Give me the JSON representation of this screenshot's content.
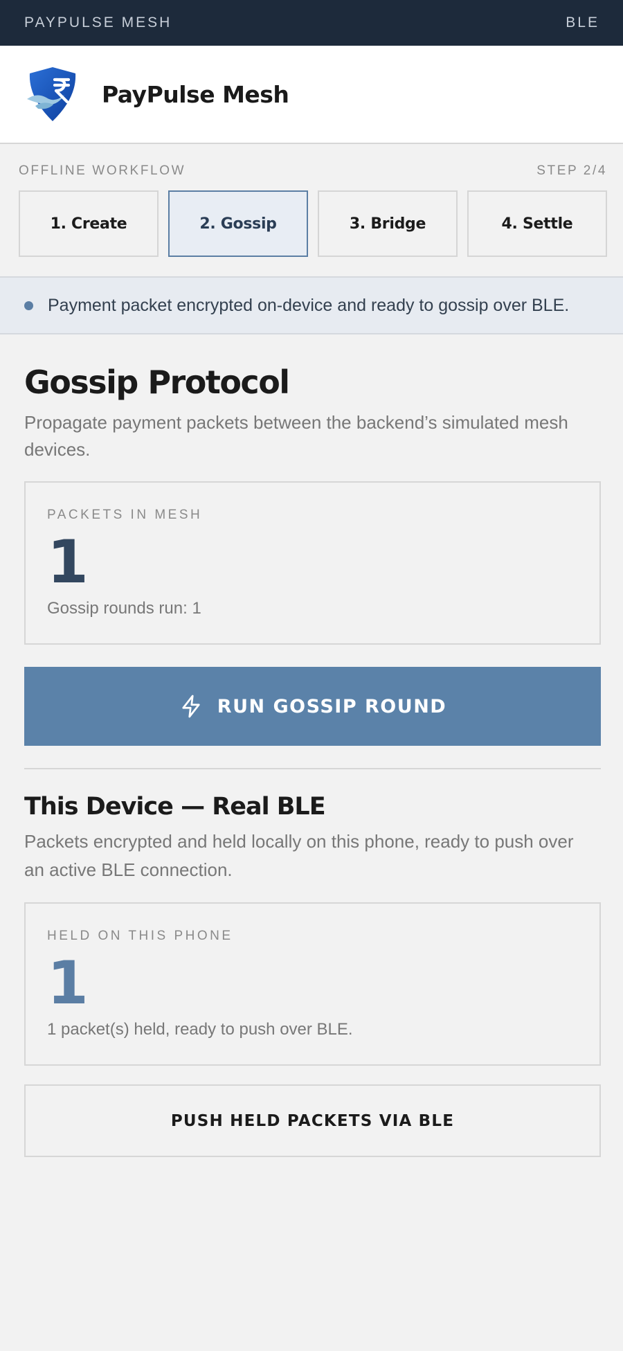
{
  "topbar": {
    "app_title": "PAYPULSE MESH",
    "link_label": "BLE"
  },
  "brand": {
    "name": "PayPulse Mesh",
    "logo_icon": "rupee-shield-logo"
  },
  "workflow": {
    "label": "OFFLINE WORKFLOW",
    "step_indicator": "STEP 2/4",
    "steps": [
      {
        "label": "1. Create",
        "active": false
      },
      {
        "label": "2. Gossip",
        "active": true
      },
      {
        "label": "3. Bridge",
        "active": false
      },
      {
        "label": "4. Settle",
        "active": false
      }
    ]
  },
  "notice": {
    "text": "Payment packet encrypted on-device and ready to gossip over BLE."
  },
  "gossip": {
    "title": "Gossip Protocol",
    "subtitle": "Propagate payment packets between the backend’s simulated mesh devices.",
    "stat": {
      "label": "PACKETS IN MESH",
      "value": "1",
      "desc": "Gossip rounds run: 1"
    },
    "run_button": {
      "label": "RUN GOSSIP ROUND",
      "icon": "bolt-icon"
    }
  },
  "device": {
    "title": "This Device — Real BLE",
    "subtitle": "Packets encrypted and held locally on this phone, ready to push over an active BLE connection.",
    "stat": {
      "label": "HELD ON THIS PHONE",
      "value": "1",
      "desc": "1 packet(s) held, ready to push over BLE."
    },
    "push_button": {
      "label": "PUSH HELD PACKETS VIA BLE"
    }
  },
  "colors": {
    "topbar": "#1d2a3b",
    "accent": "#5b82a9",
    "active_step_bg": "#e8edf4"
  }
}
